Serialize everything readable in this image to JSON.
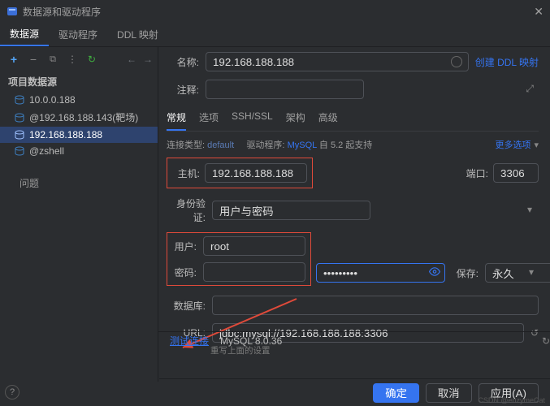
{
  "window": {
    "title": "数据源和驱动程序"
  },
  "topTabs": [
    "数据源",
    "驱动程序",
    "DDL 映射"
  ],
  "toolbar": {},
  "sidebar": {
    "header": "项目数据源",
    "items": [
      {
        "label": "10.0.0.188"
      },
      {
        "label": "@192.168.188.143(靶场)"
      },
      {
        "label": "192.168.188.188"
      },
      {
        "label": "@zshell"
      }
    ],
    "problems": "问题"
  },
  "form": {
    "name_lbl": "名称:",
    "name_val": "192.168.188.188",
    "ddl_link": "创建 DDL 映射",
    "comment_lbl": "注释:",
    "subtabs": [
      "常规",
      "选项",
      "SSH/SSL",
      "架构",
      "高级"
    ],
    "conn_type_lbl": "连接类型:",
    "conn_type_val": "default",
    "driver_lbl": "驱动程序:",
    "driver_val": "MySQL",
    "driver_ver": "自 5.2 起支持",
    "more_opts": "更多选项",
    "host_lbl": "主机:",
    "host_val": "192.168.188.188",
    "port_lbl": "端口:",
    "port_val": "3306",
    "auth_lbl": "身份验证:",
    "auth_val": "用户与密码",
    "user_lbl": "用户:",
    "user_val": "root",
    "pass_lbl": "密码:",
    "pass_val": "•••••••••",
    "save_lbl": "保存:",
    "save_val": "永久",
    "db_lbl": "数据库:",
    "url_lbl": "URL:",
    "url_val": "jdbc:mysql://192.168.188.188:3306",
    "url_note": "重写上面的设置",
    "test_link": "测试连接",
    "driver_info": "MySQL 8.0.36"
  },
  "buttons": {
    "ok": "确定",
    "cancel": "取消",
    "apply": "应用(A)"
  },
  "watermark": "CSDN @enzymeCat"
}
